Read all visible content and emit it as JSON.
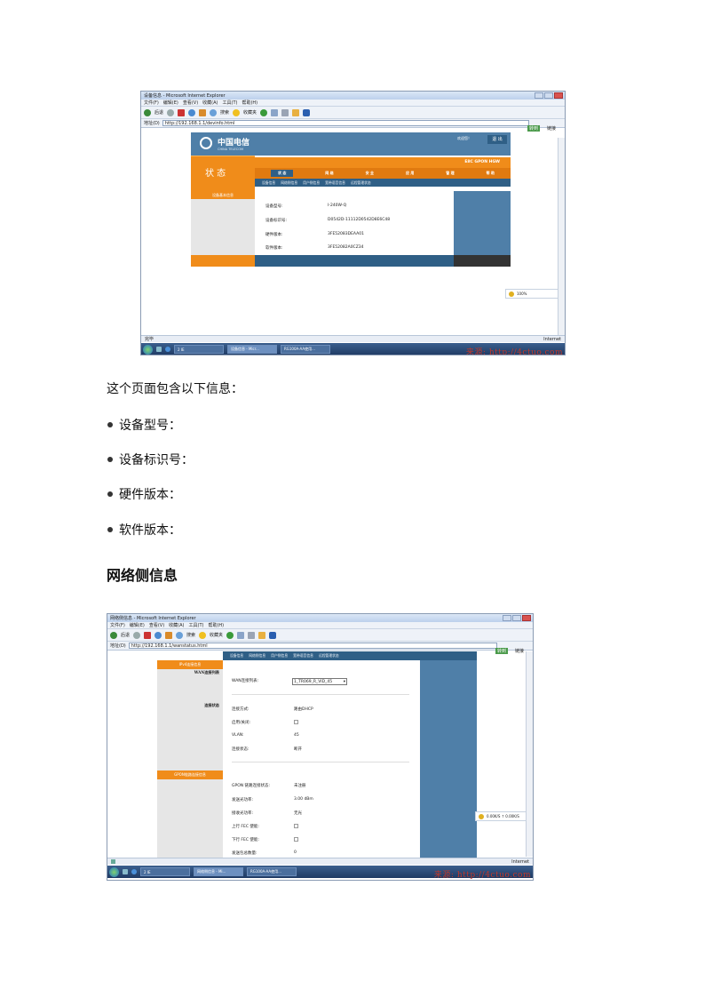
{
  "screenshot1": {
    "window_title": "设备信息 - Microsoft Internet Explorer",
    "menu": [
      "文件(F)",
      "编辑(E)",
      "查看(V)",
      "收藏(A)",
      "工具(T)",
      "帮助(H)"
    ],
    "toolbar": {
      "back": "后退",
      "search": "搜索",
      "favorites": "收藏夹"
    },
    "address_label": "地址(D)",
    "url": "http://192.168.1.1/devinfo.html",
    "go_label": "转到",
    "links_label": "链接",
    "brand_cn": "中国电信",
    "brand_en": "CHINA TELECOM",
    "welcome": "欢迎您！",
    "logout": "退 出",
    "model_banner": "E8C GPON HGW",
    "section_title": "状 态",
    "nav_tabs": [
      "状 态",
      "网 络",
      "安 全",
      "应 用",
      "管 理",
      "帮 助"
    ],
    "sub_tabs": [
      "设备信息",
      "网络侧信息",
      "用户侧信息",
      "宽带语音信息",
      "远程管理状态"
    ],
    "left_header": "设备基本信息",
    "fields": [
      {
        "label": "设备型号:",
        "value": "I-240W-Q"
      },
      {
        "label": "设备标识号:",
        "value": "D0542D-11112D0542D8E6C48"
      },
      {
        "label": "硬件版本:",
        "value": "3FE52083DEAA01"
      },
      {
        "label": "软件版本:",
        "value": "3FE52082A0CZ34"
      }
    ],
    "zoom_status": "100%",
    "status_left": "完毕",
    "status_right": "Internet",
    "taskbar_tasks": [
      "2 IE",
      "设备信息 - Micr...",
      "RG100A-AA使用..."
    ],
    "watermark": "来源: http://4ctuo.com"
  },
  "paragraph": "这个页面包含以下信息：",
  "bullets": [
    "设备型号：",
    "设备标识号：",
    "硬件版本：",
    "软件版本："
  ],
  "heading": "网络侧信息",
  "screenshot2": {
    "window_title": "网络侧信息 - Microsoft Internet Explorer",
    "menu": [
      "文件(F)",
      "编辑(E)",
      "查看(V)",
      "收藏(A)",
      "工具(T)",
      "帮助(H)"
    ],
    "toolbar": {
      "back": "后退",
      "search": "搜索",
      "favorites": "收藏夹"
    },
    "address_label": "地址(D)",
    "url": "http://192.168.1.1/wanstatus.html",
    "go_label": "转到",
    "links_label": "链接",
    "sub_tabs": [
      "设备信息",
      "网络侧信息",
      "用户侧信息",
      "宽带语音信息",
      "远程管理状态"
    ],
    "left_headers": [
      "IPv4连接信息",
      "WAN连接列表",
      "连接状态",
      "GPON链路连接信息"
    ],
    "wan_list_label": "WAN连接列表:",
    "wan_selected": "1_TR069_R_VID_45",
    "conn_fields": [
      {
        "label": "连接方式:",
        "value": "路由DHCP"
      },
      {
        "label": "启用/关闭:",
        "value": ""
      },
      {
        "label": "VLAN:",
        "value": "45"
      },
      {
        "label": "连接状态:",
        "value": "断开"
      }
    ],
    "gpon_fields": [
      {
        "label": "GPON 链路连接状态:",
        "value": "未注册"
      },
      {
        "label": "发送光功率:",
        "value": "3.00 dBm"
      },
      {
        "label": "接收光功率:",
        "value": "无光"
      },
      {
        "label": "上行 FEC 使能:",
        "value": ""
      },
      {
        "label": "下行 FEC 使能:",
        "value": ""
      },
      {
        "label": "发送包总数量:",
        "value": "0"
      }
    ],
    "zoom_status": "0.00K/S ↑ 0.00K/S",
    "status_right": "Internet",
    "taskbar_tasks": [
      "2 IE",
      "网络侧信息 - Mi...",
      "RG100A-AA使用..."
    ],
    "watermark": "来源: http://4ctuo.com"
  }
}
